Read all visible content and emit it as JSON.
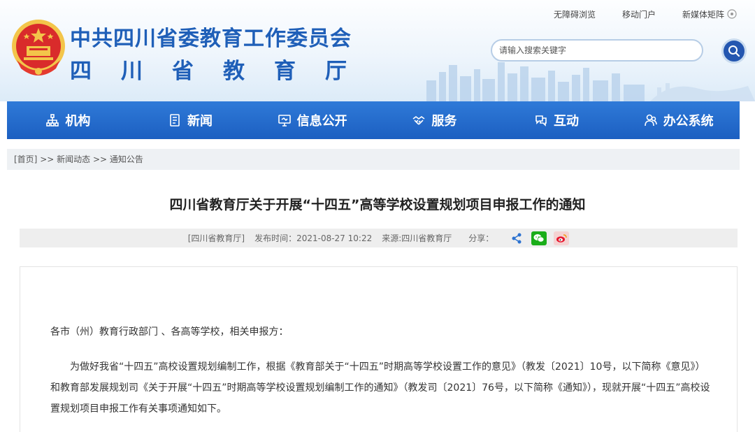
{
  "header": {
    "title_line1": "中共四川省委教育工作委员会",
    "title_line2": "四川省教育厅",
    "top_links": [
      "无障碍浏览",
      "移动门户",
      "新媒体矩阵"
    ],
    "search_placeholder": "请输入搜索关键字"
  },
  "nav": {
    "items": [
      {
        "label": "机构",
        "icon": "org-chart-icon"
      },
      {
        "label": "新闻",
        "icon": "document-icon"
      },
      {
        "label": "信息公开",
        "icon": "monitor-icon"
      },
      {
        "label": "服务",
        "icon": "handshake-icon"
      },
      {
        "label": "互动",
        "icon": "chat-icon"
      },
      {
        "label": "办公系统",
        "icon": "users-icon"
      }
    ]
  },
  "breadcrumb": {
    "home": "[首页]",
    "sep1": " >> ",
    "level1": "新闻动态",
    "sep2": " >> ",
    "level2": "通知公告"
  },
  "article": {
    "title": "四川省教育厅关于开展“十四五”高等学校设置规划项目申报工作的通知",
    "meta_source_tag": "[四川省教育厅]",
    "meta_date": "发布时间：2021-08-27 10:22",
    "meta_origin": "来源:四川省教育厅",
    "share_label": "分享：",
    "salutation": "各市（州）教育行政部门 、各高等学校，相关申报方：",
    "body": "为做好我省“十四五”高校设置规划编制工作，根据《教育部关于“十四五”时期高等学校设置工作的意见》（教发〔2021〕10号，以下简称《意见》）和教育部发展规划司《关于开展“十四五”时期高等学校设置规划编制工作的通知》（教发司〔2021〕76号，以下简称《通知》），现就开展“十四五”高校设置规划项目申报工作有关事项通知如下。"
  },
  "colors": {
    "brand_blue": "#1f5fb8",
    "nav_blue": "#2468c6",
    "wechat_green": "#1aad19",
    "weibo_red": "#e6162d"
  }
}
